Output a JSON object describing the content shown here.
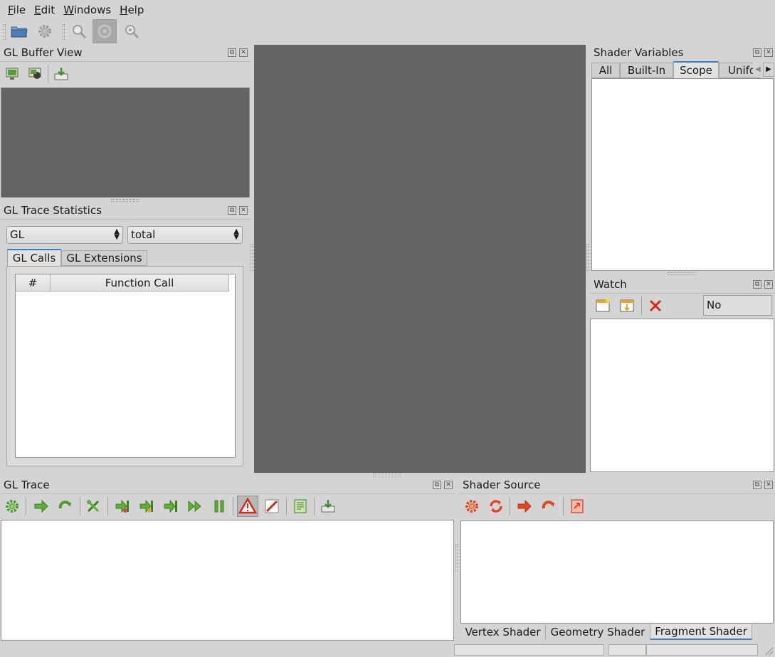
{
  "menu": [
    {
      "label": "File",
      "accel": "F",
      "rest": "ile"
    },
    {
      "label": "Edit",
      "accel": "E",
      "rest": "dit"
    },
    {
      "label": "Windows",
      "accel": "W",
      "rest": "indows"
    },
    {
      "label": "Help",
      "accel": "H",
      "rest": "elp"
    }
  ],
  "toolbar": {
    "icons": [
      "open-folder-icon",
      "gear-icon",
      "zoom-icon",
      "target-icon",
      "zoom-reset-icon"
    ]
  },
  "buffer_view": {
    "title": "GL Buffer View"
  },
  "trace_stats": {
    "title": "GL Trace Statistics",
    "combo1": "GL",
    "combo2": "total",
    "tabs": [
      "GL Calls",
      "GL Extensions"
    ],
    "columns": [
      "#",
      "Function Call"
    ]
  },
  "shader_vars": {
    "title": "Shader Variables",
    "tabs": [
      "All",
      "Built-In",
      "Scope",
      "Unifo"
    ]
  },
  "watch": {
    "title": "Watch",
    "selection": "No Selection"
  },
  "gl_trace": {
    "title": "GL Trace"
  },
  "shader_source": {
    "title": "Shader Source",
    "tabs": [
      "Vertex Shader",
      "Geometry Shader",
      "Fragment Shader"
    ]
  },
  "colors": {
    "accent": "#3a7fc4",
    "central": "#646464",
    "buffer_bg": "#646464",
    "green_icon": "#4e9a2a",
    "red_icon": "#e2461f"
  }
}
